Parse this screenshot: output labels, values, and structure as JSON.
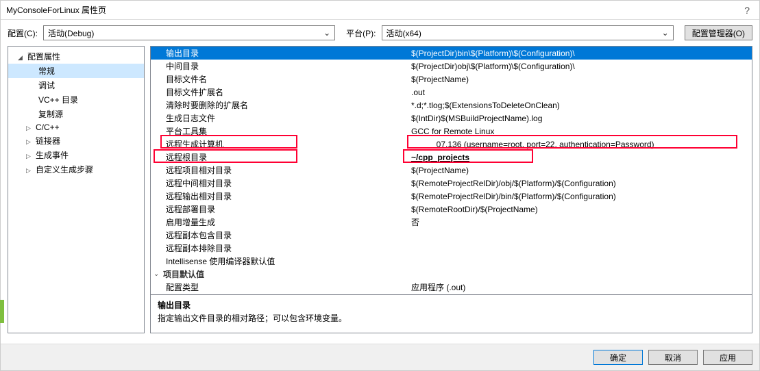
{
  "title": "MyConsoleForLinux 属性页",
  "helpGlyph": "?",
  "config": {
    "label_config": "配置(C):",
    "value_config": "活动(Debug)",
    "label_platform": "平台(P):",
    "value_platform": "活动(x64)",
    "btn_config_manager": "配置管理器(O)"
  },
  "tree": {
    "root": "配置属性",
    "items": [
      {
        "label": "常规",
        "selected": true
      },
      {
        "label": "调试"
      },
      {
        "label": "VC++ 目录"
      },
      {
        "label": "复制源"
      },
      {
        "label": "C/C++",
        "expandable": true
      },
      {
        "label": "链接器",
        "expandable": true
      },
      {
        "label": "生成事件",
        "expandable": true
      },
      {
        "label": "自定义生成步骤",
        "expandable": true
      }
    ]
  },
  "props": {
    "rows": [
      {
        "name": "输出目录",
        "value": "$(ProjectDir)bin\\$(Platform)\\$(Configuration)\\",
        "selected": true
      },
      {
        "name": "中间目录",
        "value": "$(ProjectDir)obj\\$(Platform)\\$(Configuration)\\"
      },
      {
        "name": "目标文件名",
        "value": "$(ProjectName)"
      },
      {
        "name": "目标文件扩展名",
        "value": ".out"
      },
      {
        "name": "清除时要删除的扩展名",
        "value": "*.d;*.tlog;$(ExtensionsToDeleteOnClean)"
      },
      {
        "name": "生成日志文件",
        "value": "$(IntDir)$(MSBuildProjectName).log"
      },
      {
        "name": "平台工具集",
        "value": "GCC for Remote Linux"
      },
      {
        "name": "远程生成计算机",
        "value": "           07.136 (username=root, port=22, authentication=Password)"
      },
      {
        "name": "远程根目录",
        "value": "~/cpp_projects",
        "boldUnderline": true
      },
      {
        "name": "远程项目相对目录",
        "value": "$(ProjectName)"
      },
      {
        "name": "远程中间相对目录",
        "value": "$(RemoteProjectRelDir)/obj/$(Platform)/$(Configuration)"
      },
      {
        "name": "远程输出相对目录",
        "value": "$(RemoteProjectRelDir)/bin/$(Platform)/$(Configuration)"
      },
      {
        "name": "远程部署目录",
        "value": "$(RemoteRootDir)/$(ProjectName)"
      },
      {
        "name": "启用增量生成",
        "value": "否"
      },
      {
        "name": "远程副本包含目录",
        "value": ""
      },
      {
        "name": "远程副本排除目录",
        "value": ""
      },
      {
        "name": "Intellisense 使用编译器默认值",
        "value": ""
      }
    ],
    "group2": "项目默认值",
    "group2_rows": [
      {
        "name": "配置类型",
        "value": "应用程序 (.out)"
      }
    ]
  },
  "description": {
    "title": "输出目录",
    "text": "指定输出文件目录的相对路径；可以包含环境变量。"
  },
  "footer": {
    "ok": "确定",
    "cancel": "取消",
    "apply": "应用"
  },
  "chevDown": "⌄"
}
